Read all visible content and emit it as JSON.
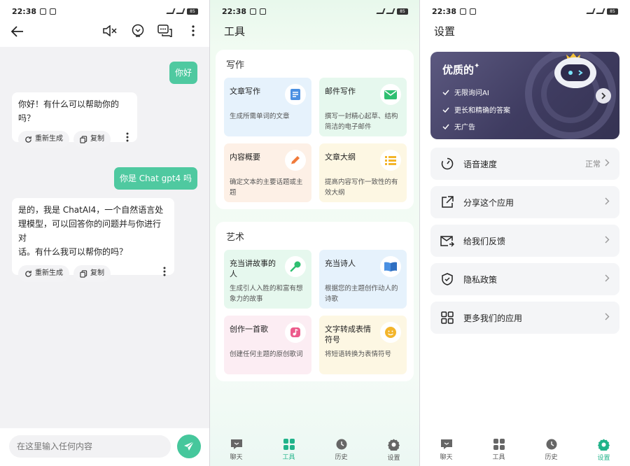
{
  "status": {
    "time": "22:38",
    "battery": "85"
  },
  "chat": {
    "messages": [
      {
        "role": "user",
        "text": "你好"
      },
      {
        "role": "ai",
        "text": "你好！有什么可以帮助你的吗？"
      },
      {
        "role": "user",
        "text": "你是 Chat gpt4 吗"
      },
      {
        "role": "ai",
        "lines": [
          "是的，我是 ChatAI4，一个自然语言处",
          "理模型，可以回答你的问题并与你进行对",
          "话。有什么我可以帮你的吗？"
        ]
      }
    ],
    "regenerate_label": "重新生成",
    "copy_label": "复制",
    "input_placeholder": "在这里输入任何内容"
  },
  "tools": {
    "title": "工具",
    "sections": [
      {
        "title": "写作",
        "items": [
          {
            "name": "文章写作",
            "desc": "生成所需单词的文章",
            "icon": "document-icon",
            "color": "#4a90e2"
          },
          {
            "name": "邮件写作",
            "desc": "撰写一封精心起草、结构简洁的电子邮件",
            "icon": "mail-icon",
            "color": "#2fbf71"
          },
          {
            "name": "内容概要",
            "desc": "确定文本的主要话题或主题",
            "icon": "pencil-icon",
            "color": "#f07a3a"
          },
          {
            "name": "文章大纲",
            "desc": "提高内容写作一致性的有效大纲",
            "icon": "list-icon",
            "color": "#f3b52b"
          }
        ]
      },
      {
        "title": "艺术",
        "items": [
          {
            "name": "充当讲故事的人",
            "desc": "生成引人入胜的和富有想象力的故事",
            "icon": "microphone-icon",
            "color": "#2fbf71"
          },
          {
            "name": "充当诗人",
            "desc": "根据您的主题创作动人的诗歌",
            "icon": "book-icon",
            "color": "#4a90e2"
          },
          {
            "name": "创作一首歌",
            "desc": "创建任何主题的原创歌词",
            "icon": "music-icon",
            "color": "#ec5b8c"
          },
          {
            "name": "文字转成表情符号",
            "desc": "将短语转换为表情符号",
            "icon": "smile-icon",
            "color": "#f3b52b"
          }
        ]
      }
    ]
  },
  "settings": {
    "title": "设置",
    "premium": {
      "title": "优质的",
      "features": [
        "无限询问AI",
        "更长和精确的答案",
        "无广告"
      ]
    },
    "items": [
      {
        "label": "语音速度",
        "value": "正常",
        "icon": "speed-icon"
      },
      {
        "label": "分享这个应用",
        "value": "",
        "icon": "share-icon"
      },
      {
        "label": "给我们反馈",
        "value": "",
        "icon": "feedback-icon"
      },
      {
        "label": "隐私政策",
        "value": "",
        "icon": "shield-icon"
      },
      {
        "label": "更多我们的应用",
        "value": "",
        "icon": "apps-icon"
      }
    ]
  },
  "tabs": [
    "聊天",
    "工具",
    "历史",
    "设置"
  ],
  "colors": {
    "accent": "#21b38a",
    "bubble": "#4fc9a0"
  }
}
